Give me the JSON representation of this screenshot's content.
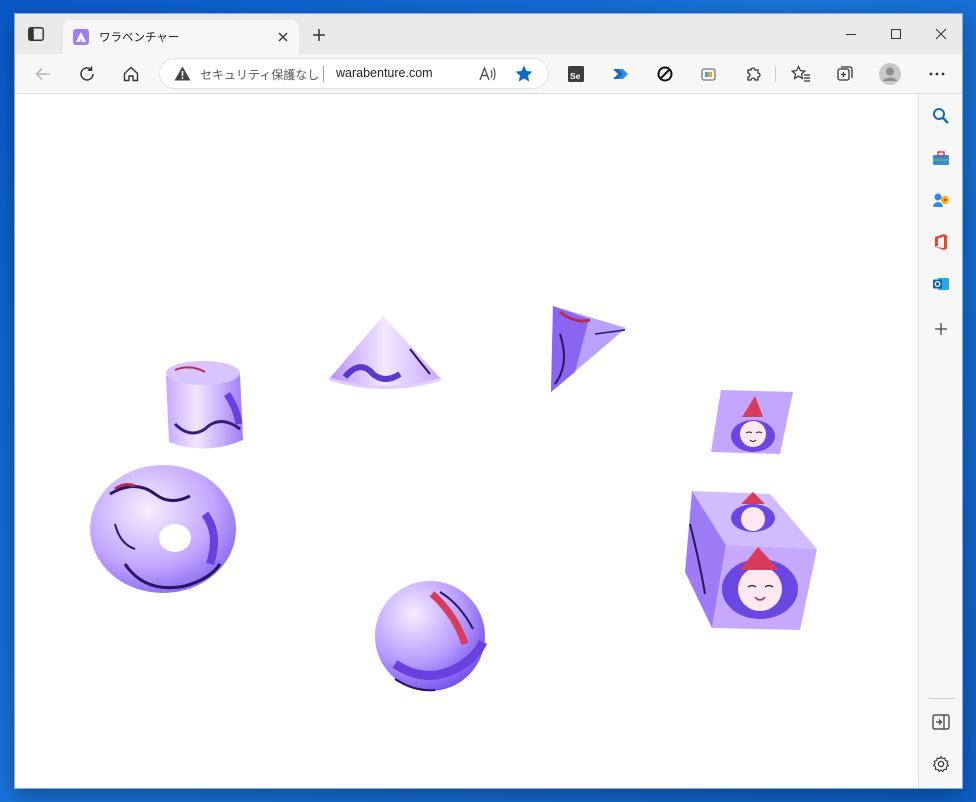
{
  "tab": {
    "title": "ワラベンチャー"
  },
  "addressbar": {
    "security_text": "セキュリティ保護なし",
    "url": "warabenture.com"
  },
  "colors": {
    "accent_blue": "#0f6cbd",
    "shape_purple": "#a48bff",
    "shape_light": "#e9d8ff",
    "desktop_blue": "#1a73d9"
  },
  "icons": {
    "toolbar": [
      "back-icon",
      "refresh-icon",
      "home-icon",
      "read-aloud-icon",
      "favorite-star-icon",
      "selenium-extension-icon",
      "power-automate-icon",
      "block-icon",
      "collections-icon",
      "extensions-icon",
      "favorites-icon",
      "collections-add-icon",
      "profile-icon",
      "more-icon"
    ],
    "sidebar": [
      "search-icon",
      "tools-icon",
      "people-icon",
      "office-icon",
      "outlook-icon",
      "add-icon",
      "hide-sidebar-icon",
      "settings-icon"
    ]
  },
  "scene_shapes": [
    "cylinder",
    "cone",
    "triangular-prism",
    "plane",
    "torus",
    "cube",
    "sphere"
  ]
}
